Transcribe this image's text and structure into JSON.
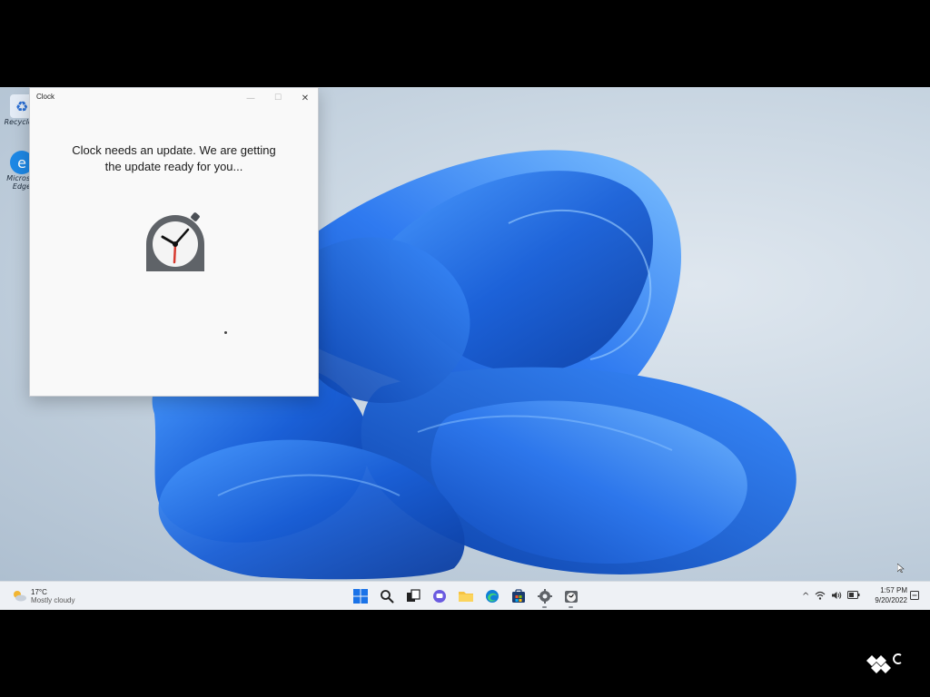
{
  "desktop": {
    "icons": [
      {
        "name": "recycle-bin",
        "label": "Recycle..."
      },
      {
        "name": "edge",
        "label": "Micros... Edge"
      }
    ]
  },
  "clock_window": {
    "title": "Clock",
    "message_line1": "Clock needs an update. We are getting",
    "message_line2": "the update ready for you...",
    "controls": {
      "minimize": "—",
      "maximize": "☐",
      "close": "✕"
    }
  },
  "taskbar": {
    "weather": {
      "temp": "17°C",
      "condition": "Mostly cloudy"
    },
    "apps": [
      "start-icon",
      "search-icon",
      "task-view-icon",
      "chat-icon",
      "file-explorer-icon",
      "edge-icon",
      "store-icon",
      "settings-icon",
      "clock-app-icon"
    ],
    "tray": {
      "chevron": "^",
      "wifi": "wifi-icon",
      "volume": "volume-icon",
      "battery": "battery-icon"
    },
    "time": "1:57 PM",
    "date": "9/20/2022"
  },
  "colors": {
    "accent_blue": "#1a5fd6",
    "clock_hand_red": "#d73a2f",
    "clock_body": "#5f6368"
  }
}
